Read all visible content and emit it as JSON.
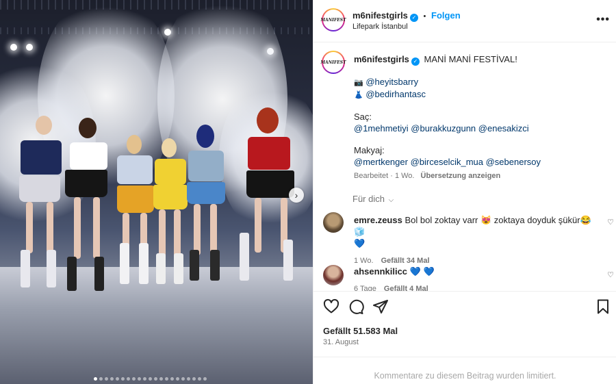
{
  "post": {
    "image_alt": "Performers on stage at Mani Mani Festival",
    "carousel": {
      "total": 21,
      "active": 1
    }
  },
  "header": {
    "username": "m6nifestgirls",
    "avatar_text": "MANIFEST",
    "verified": true,
    "separator": "•",
    "follow_label": "Folgen",
    "location": "Lifepark İstanbul",
    "more_icon": "more-horizontal-icon"
  },
  "caption": {
    "username": "m6nifestgirls",
    "title": "MANİ MANİ FESTİVAL!",
    "credits": [
      {
        "emoji": "📷",
        "handle": "@heyitsbarry"
      },
      {
        "emoji": "👗",
        "handle": "@bedirhantasc"
      }
    ],
    "hair_label": "Saç:",
    "hair_handles": [
      "@1mehmetiyi",
      "@burakkuzgunn",
      "@enesakizci"
    ],
    "makeup_label": "Makyaj:",
    "makeup_handles": [
      "@mertkenger",
      "@birceselcik_mua",
      "@sebenersoy"
    ],
    "edited": "Bearbeitet",
    "time": "1 Wo.",
    "translate": "Übersetzung anzeigen"
  },
  "for_you": "Für dich",
  "comments": [
    {
      "username": "emre.zeuss",
      "text_a": "Bol bol zoktay varr 😻 zoktaya doyduk şükür😂🧊",
      "text_b": "💙",
      "time": "1 Wo.",
      "likes": "Gefällt 34 Mal"
    },
    {
      "username": "ahsennkilicc",
      "text_a": "💙 💙",
      "time": "6 Tage",
      "likes": "Gefällt 4 Mal"
    }
  ],
  "actions": {
    "like_icon": "heart-icon",
    "comment_icon": "comment-icon",
    "share_icon": "send-icon",
    "save_icon": "bookmark-icon",
    "likes": "Gefällt 51.583 Mal",
    "date": "31. August"
  },
  "footer": {
    "limited": "Kommentare zu diesem Beitrag wurden limitiert."
  },
  "colors": {
    "link": "#00376b",
    "accent": "#0095f6",
    "muted": "#737373"
  }
}
